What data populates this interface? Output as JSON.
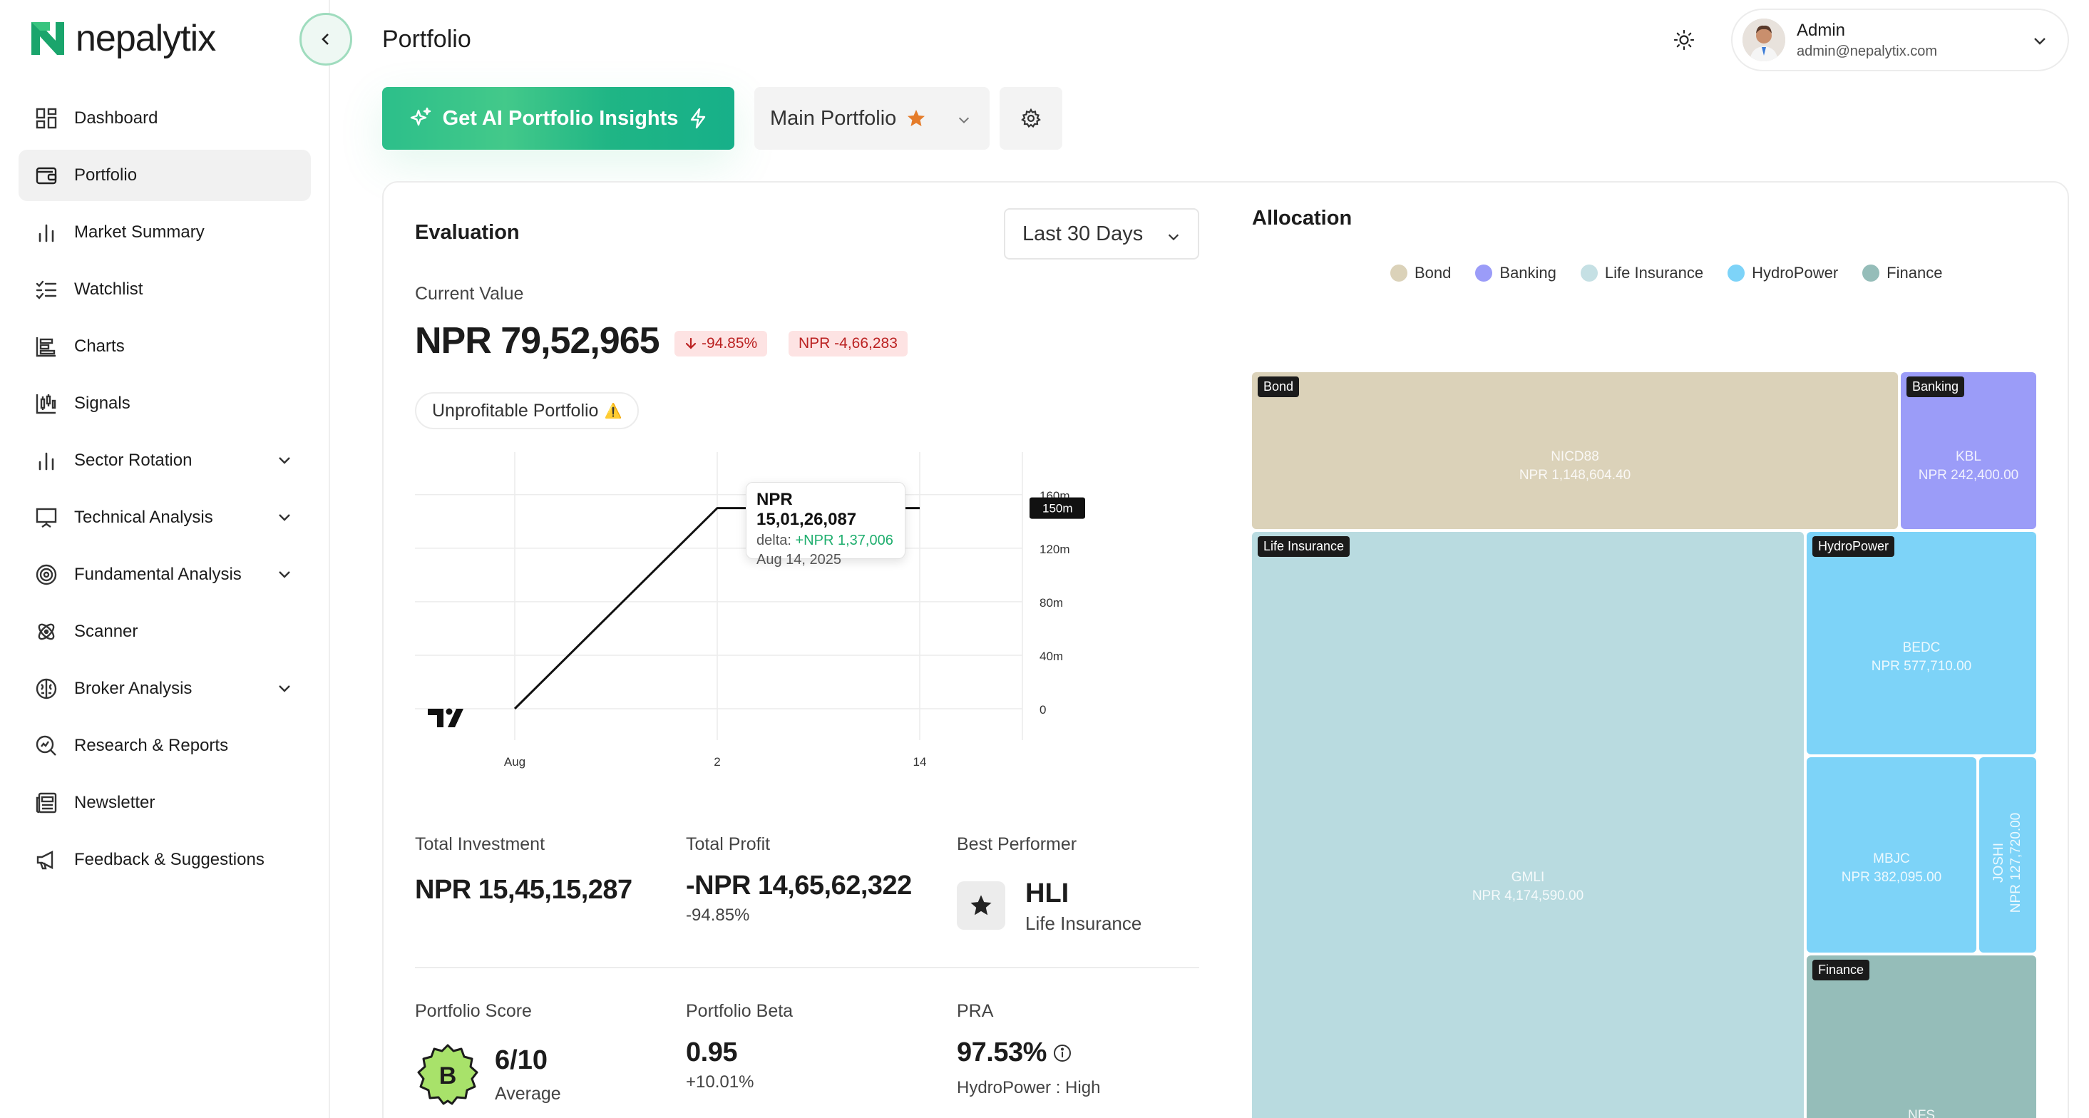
{
  "app": {
    "brand": "nepalytix",
    "page_title": "Portfolio"
  },
  "sidebar": {
    "items": [
      {
        "label": "Dashboard",
        "icon": "dashboard-icon",
        "active": false
      },
      {
        "label": "Portfolio",
        "icon": "wallet-icon",
        "active": true
      },
      {
        "label": "Market Summary",
        "icon": "bar-chart-icon",
        "active": false
      },
      {
        "label": "Watchlist",
        "icon": "checklist-icon",
        "active": false
      },
      {
        "label": "Charts",
        "icon": "chart-icon",
        "active": false
      },
      {
        "label": "Signals",
        "icon": "signals-icon",
        "active": false
      },
      {
        "label": "Sector Rotation",
        "icon": "bar-chart-icon",
        "active": false,
        "expandable": true
      },
      {
        "label": "Technical Analysis",
        "icon": "presentation-icon",
        "active": false,
        "expandable": true
      },
      {
        "label": "Fundamental Analysis",
        "icon": "target-icon",
        "active": false,
        "expandable": true
      },
      {
        "label": "Scanner",
        "icon": "atom-icon",
        "active": false
      },
      {
        "label": "Broker Analysis",
        "icon": "brain-icon",
        "active": false,
        "expandable": true
      },
      {
        "label": "Research & Reports",
        "icon": "search-chart-icon",
        "active": false
      },
      {
        "label": "Newsletter",
        "icon": "newspaper-icon",
        "active": false
      },
      {
        "label": "Feedback & Suggestions",
        "icon": "megaphone-icon",
        "active": false
      }
    ]
  },
  "user": {
    "name": "Admin",
    "email": "admin@nepalytix.com"
  },
  "toolbar": {
    "ai_label": "Get AI Portfolio Insights",
    "portfolio_name": "Main Portfolio"
  },
  "evaluation": {
    "title": "Evaluation",
    "range": "Last 30 Days",
    "current_value_label": "Current Value",
    "current_value": "NPR 79,52,965",
    "change_pct": "-94.85%",
    "change_amt": "NPR -4,66,283",
    "status": "Unprofitable Portfolio",
    "status_icon": "⚠️"
  },
  "chart_data": {
    "type": "line",
    "x": [
      "Aug 1",
      "Aug 2",
      "Aug 13",
      "Aug 14"
    ],
    "values": [
      0,
      150,
      150,
      150
    ],
    "y_unit": "m",
    "x_tick_labels": [
      "Aug",
      "2",
      "14"
    ],
    "y_tick_labels": [
      "0",
      "40m",
      "80m",
      "120m",
      "160m"
    ],
    "ylim": [
      0,
      160
    ],
    "last_value_label": "150m",
    "grid": true,
    "tooltip": {
      "value": "NPR 15,01,26,087",
      "delta_label": "delta:",
      "delta": "+NPR 1,37,006",
      "date": "Aug 14, 2025"
    }
  },
  "stats": {
    "total_investment_label": "Total Investment",
    "total_investment": "NPR 15,45,15,287",
    "total_profit_label": "Total Profit",
    "total_profit": "-NPR 14,65,62,322",
    "total_profit_pct": "-94.85%",
    "best_performer_label": "Best Performer",
    "best_performer_code": "HLI",
    "best_performer_sector": "Life Insurance",
    "score_label": "Portfolio Score",
    "score_grade": "B",
    "score": "6/10",
    "score_desc": "Average",
    "beta_label": "Portfolio Beta",
    "beta": "0.95",
    "beta_change": "+10.01%",
    "pra_label": "PRA",
    "pra": "97.53%",
    "pra_desc": "HydroPower : High"
  },
  "allocation": {
    "title": "Allocation",
    "legend": [
      {
        "label": "Bond",
        "color": "#dbd2b9"
      },
      {
        "label": "Banking",
        "color": "#9b9cf8"
      },
      {
        "label": "Life Insurance",
        "color": "#b9dbe0"
      },
      {
        "label": "HydroPower",
        "color": "#7dd3f8"
      },
      {
        "label": "Finance",
        "color": "#95bdb9"
      }
    ],
    "tiles": {
      "nicd88": {
        "sector": "Bond",
        "symbol": "NICD88",
        "value": "NPR 1,148,604.40"
      },
      "kbl": {
        "sector": "Banking",
        "symbol": "KBL",
        "value": "NPR 242,400.00"
      },
      "gmli": {
        "sector": "Life Insurance",
        "symbol": "GMLI",
        "value": "NPR 4,174,590.00"
      },
      "bedc": {
        "sector": "HydroPower",
        "symbol": "BEDC",
        "value": "NPR 577,710.00"
      },
      "mbjc": {
        "symbol": "MBJC",
        "value": "NPR 382,095.00"
      },
      "joshi": {
        "symbol": "JOSHI",
        "value": "NPR 127,720.00"
      },
      "nfs": {
        "sector": "Finance",
        "symbol": "NFS"
      }
    }
  }
}
